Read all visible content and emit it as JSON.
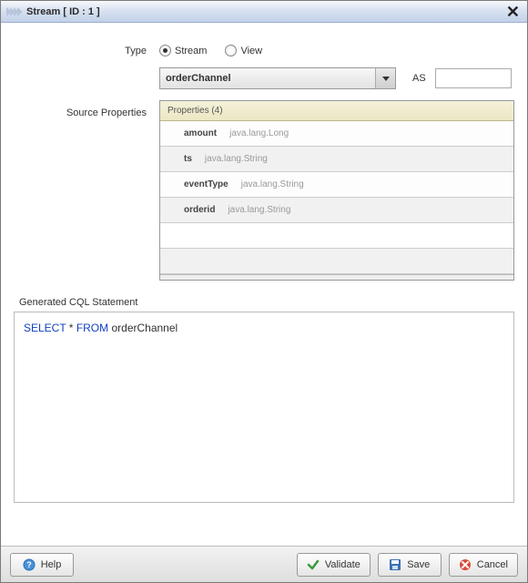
{
  "window": {
    "title": "Stream [ ID : 1 ]"
  },
  "form": {
    "type_label": "Type",
    "radio_stream": "Stream",
    "radio_view": "View",
    "type_selected": "stream",
    "source_dropdown": "orderChannel",
    "as_label": "AS",
    "as_value": "",
    "source_properties_label": "Source Properties",
    "properties_header": "Properties (4)",
    "properties": [
      {
        "name": "amount",
        "type": "java.lang.Long"
      },
      {
        "name": "ts",
        "type": "java.lang.String"
      },
      {
        "name": "eventType",
        "type": "java.lang.String"
      },
      {
        "name": "orderid",
        "type": "java.lang.String"
      }
    ]
  },
  "cql": {
    "section_label": "Generated CQL Statement",
    "kw_select": "SELECT",
    "star": " * ",
    "kw_from": "FROM",
    "tail": " orderChannel"
  },
  "buttons": {
    "help": "Help",
    "validate": "Validate",
    "save": "Save",
    "cancel": "Cancel"
  }
}
